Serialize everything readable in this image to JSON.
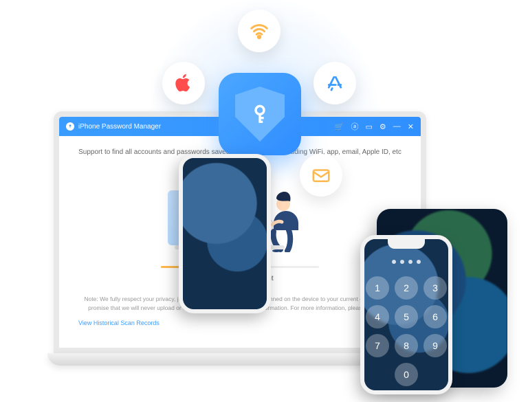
{
  "titlebar": {
    "title": "iPhone Password Manager",
    "icons": [
      "cart",
      "user",
      "message",
      "gear",
      "minimize",
      "close"
    ]
  },
  "body": {
    "support_text": "Support to find all accounts and passwords saved on your device, including WiFi, app, email, Apple ID, etc",
    "scanning_text": "Scanning, please wait",
    "note": "Note: We fully respect your privacy, just save the account password scanned on the device to your current computer. We promise that we will never upload or collect any of your password information. For more information, please visit our p",
    "link": "View Historical Scan Records"
  },
  "orbs": {
    "wifi": "wifi-icon",
    "apple": "apple-logo-icon",
    "appstore": "appstore-icon",
    "phone": "phone-icon",
    "mail": "mail-icon"
  },
  "keypad": [
    "1",
    "2",
    "3",
    "4",
    "5",
    "6",
    "7",
    "8",
    "9",
    "",
    "0",
    ""
  ],
  "colors": {
    "accent": "#3b9cff",
    "accent2": "#ffb84d"
  }
}
